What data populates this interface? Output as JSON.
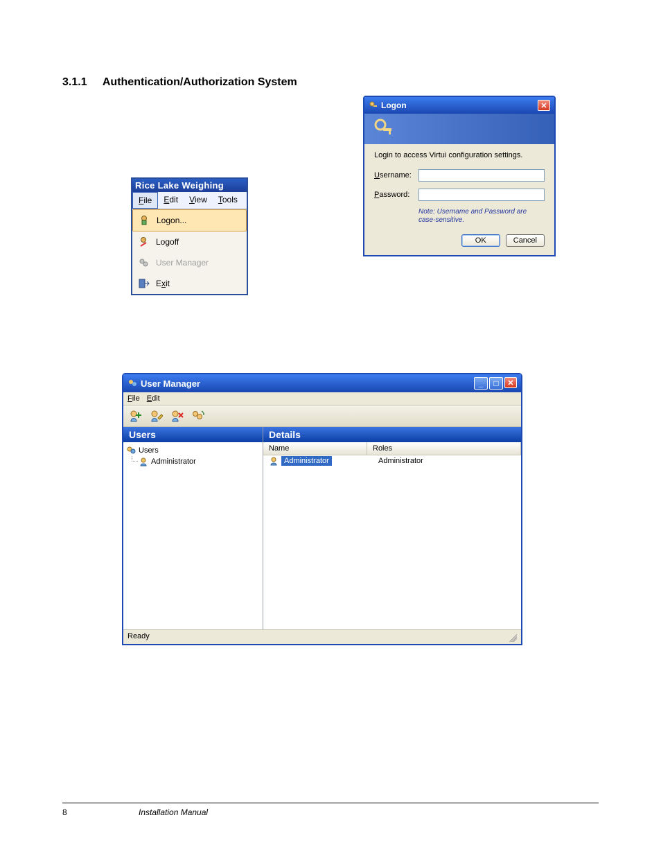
{
  "heading": {
    "number": "3.1.1",
    "title": "Authentication/Authorization System"
  },
  "file_menu": {
    "titlebar": "Rice Lake Weighing",
    "menubar": [
      "File",
      "Edit",
      "View",
      "Tools"
    ],
    "items": [
      {
        "label": "Logon...",
        "icon": "user-key",
        "selected": true
      },
      {
        "label": "Logoff",
        "icon": "user-off",
        "selected": false
      },
      {
        "label": "User Manager",
        "icon": "users-gear",
        "selected": false,
        "disabled": true
      },
      {
        "label": "Exit",
        "icon": "exit-door",
        "selected": false
      }
    ]
  },
  "logon": {
    "title": "Logon",
    "instruction": "Login to access Virtui configuration settings.",
    "username_label": "Username:",
    "password_label": "Password:",
    "username_value": "",
    "password_value": "",
    "note": "Note: Username and Password are case-sensitive.",
    "ok": "OK",
    "cancel": "Cancel"
  },
  "user_manager": {
    "title": "User Manager",
    "menubar": [
      "File",
      "Edit"
    ],
    "toolbar": [
      "add-user",
      "edit-user",
      "delete-user",
      "refresh-users"
    ],
    "left_header": "Users",
    "right_header": "Details",
    "tree": {
      "root": "Users",
      "children": [
        "Administrator"
      ]
    },
    "columns": [
      "Name",
      "Roles"
    ],
    "rows": [
      {
        "name": "Administrator",
        "roles": "Administrator",
        "selected": true
      }
    ],
    "status": "Ready"
  },
  "footer": {
    "page": "8",
    "manual": "Installation Manual"
  }
}
